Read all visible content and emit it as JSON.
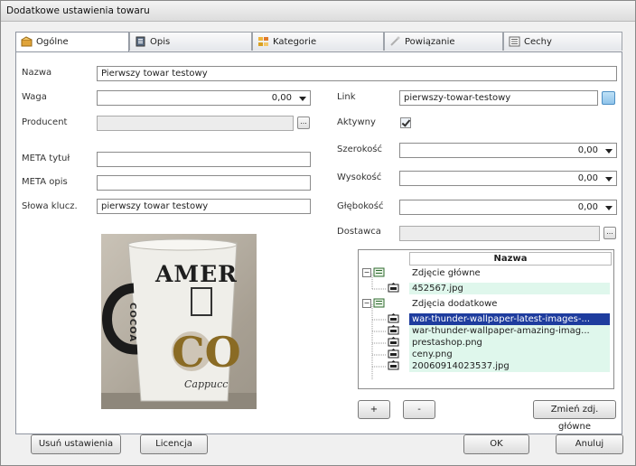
{
  "window": {
    "title": "Dodatkowe ustawienia towaru"
  },
  "tabs": [
    {
      "label": "Ogólne",
      "icon": "box-icon",
      "active": true
    },
    {
      "label": "Opis",
      "icon": "document-icon",
      "active": false
    },
    {
      "label": "Kategorie",
      "icon": "category-icon",
      "active": false
    },
    {
      "label": "Powiązanie",
      "icon": "link-icon",
      "active": false
    },
    {
      "label": "Cechy",
      "icon": "features-icon",
      "active": false
    }
  ],
  "form": {
    "nazwa": {
      "label": "Nazwa",
      "value": "Pierwszy towar testowy"
    },
    "waga": {
      "label": "Waga",
      "value": "0,00"
    },
    "producent": {
      "label": "Producent",
      "value": ""
    },
    "meta_tytul": {
      "label": "META tytuł",
      "value": ""
    },
    "meta_opis": {
      "label": "META opis",
      "value": ""
    },
    "slowa": {
      "label": "Słowa klucz.",
      "value": "pierwszy towar testowy"
    },
    "link": {
      "label": "Link",
      "value": "pierwszy-towar-testowy"
    },
    "aktywny": {
      "label": "Aktywny",
      "checked": true
    },
    "szerokosc": {
      "label": "Szerokość",
      "value": "0,00"
    },
    "wysokosc": {
      "label": "Wysokość",
      "value": "0,00"
    },
    "glebokosc": {
      "label": "Głębokość",
      "value": "0,00"
    },
    "dostawca": {
      "label": "Dostawca",
      "value": ""
    }
  },
  "photo": {
    "text_top": "AMER",
    "text_side": "COCOA",
    "text_big": "CO",
    "text_bottom": "Cappucc"
  },
  "images_grid": {
    "header": "Nazwa",
    "groups": [
      {
        "label": "Zdjęcie główne",
        "items": [
          "452567.jpg"
        ]
      },
      {
        "label": "Zdjęcia dodatkowe",
        "items": [
          "war-thunder-wallpaper-latest-images-...",
          "war-thunder-wallpaper-amazing-imag...",
          "prestashop.png",
          "ceny.png",
          "20060914023537.jpg"
        ]
      }
    ],
    "selected": "war-thunder-wallpaper-latest-images-..."
  },
  "buttons": {
    "add": "+",
    "remove": "-",
    "set_main": "Zmień zdj. główne",
    "reset": "Usuń ustawienia",
    "license": "Licencja",
    "ok": "OK",
    "cancel": "Anuluj",
    "ellipsis": "..."
  },
  "colors": {
    "selection": "#1e3c9e",
    "row_green": "#dff7ec",
    "link_button": "#8fc3ea"
  }
}
